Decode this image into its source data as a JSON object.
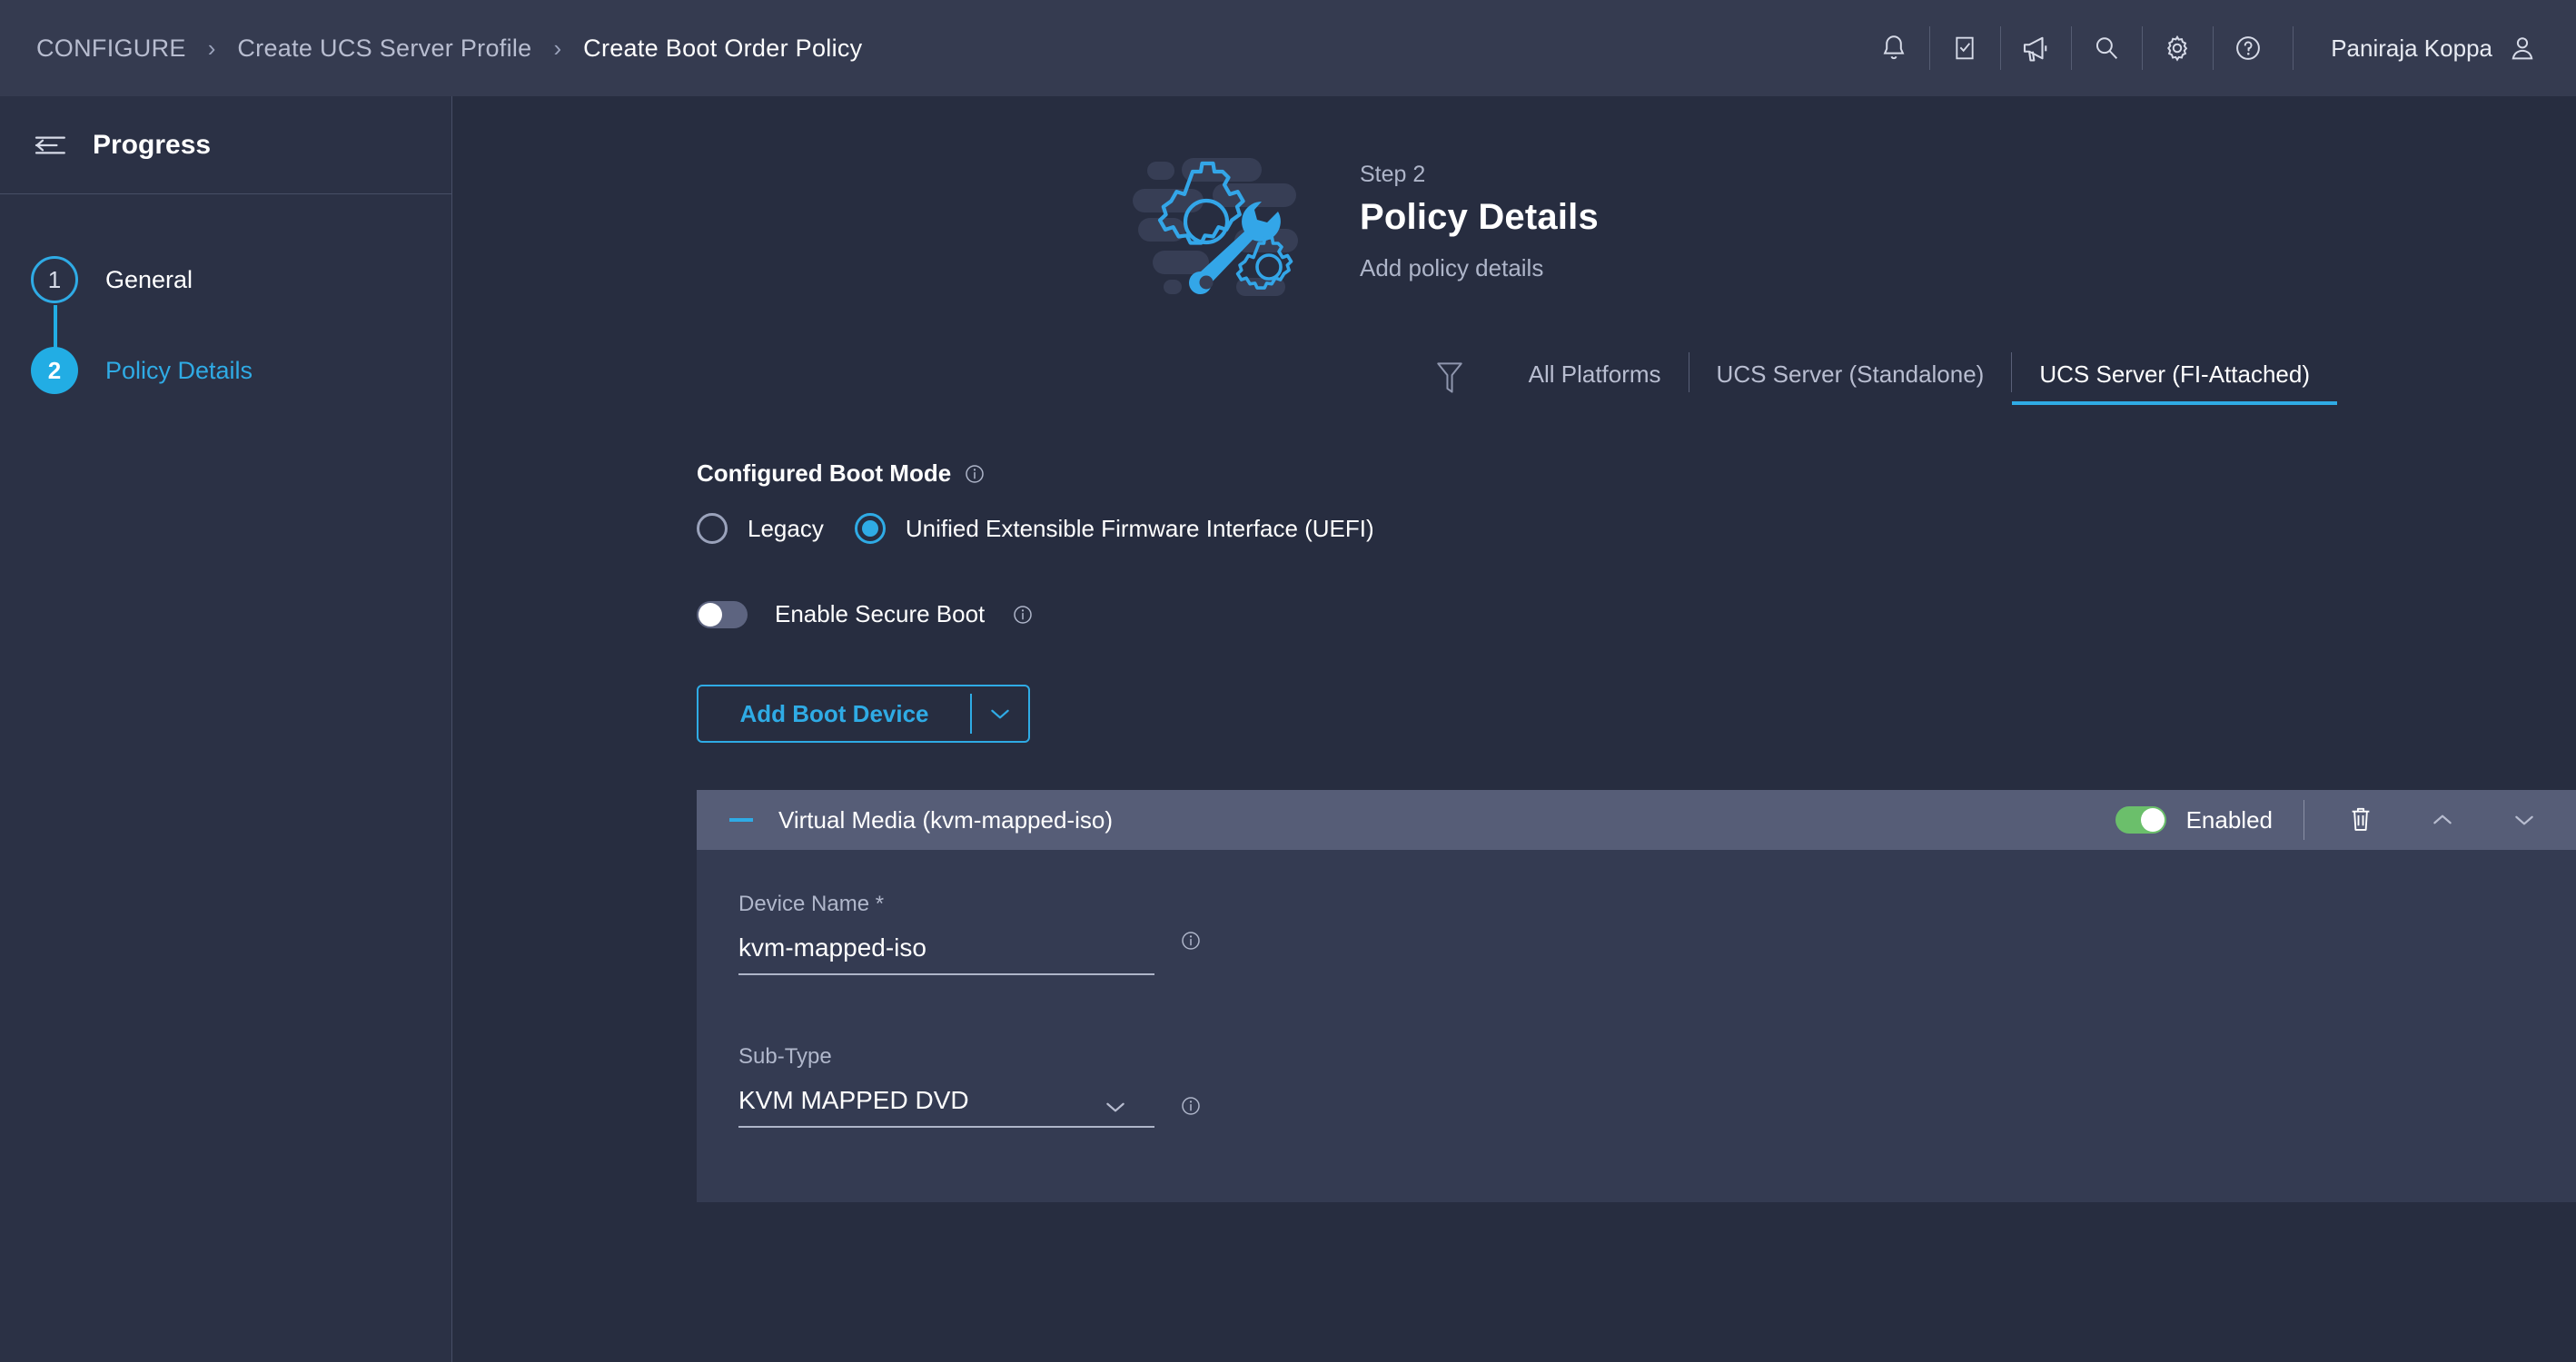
{
  "topbar": {
    "breadcrumb": [
      {
        "label": "CONFIGURE",
        "active": false
      },
      {
        "label": "Create UCS Server Profile",
        "active": false
      },
      {
        "label": "Create Boot Order Policy",
        "active": true
      }
    ],
    "separator": "›",
    "icons": [
      "bell-icon",
      "checklist-icon",
      "megaphone-icon",
      "search-icon",
      "gear-icon",
      "help-icon"
    ],
    "user": "Paniraja Koppa"
  },
  "sidebar": {
    "collapse_icon": "collapse-panel-icon",
    "title": "Progress",
    "steps": [
      {
        "number": "1",
        "label": "General",
        "state": "todo"
      },
      {
        "number": "2",
        "label": "Policy Details",
        "state": "current"
      }
    ]
  },
  "page": {
    "step_kicker": "Step 2",
    "title": "Policy Details",
    "subtitle": "Add policy details",
    "illustration": "gear-wrench-illustration"
  },
  "tabs": {
    "filter_icon": "filter-icon",
    "items": [
      {
        "label": "All Platforms",
        "selected": false
      },
      {
        "label": "UCS Server (Standalone)",
        "selected": false
      },
      {
        "label": "UCS Server (FI-Attached)",
        "selected": true
      }
    ]
  },
  "boot_mode": {
    "label": "Configured Boot Mode",
    "info_icon": "info-icon",
    "options": [
      {
        "label": "Legacy",
        "selected": false
      },
      {
        "label": "Unified Extensible Firmware Interface (UEFI)",
        "selected": true
      }
    ]
  },
  "secure_boot": {
    "label": "Enable Secure Boot",
    "info_icon": "info-icon",
    "state": "off"
  },
  "add_boot_device": {
    "label": "Add Boot Device",
    "caret_icon": "chevron-down-icon"
  },
  "device_card": {
    "collapse_icon": "minus-icon",
    "title": "Virtual Media (kvm-mapped-iso)",
    "toggle_state": "on",
    "toggle_label": "Enabled",
    "delete_icon": "trash-icon",
    "move_up_icon": "chevron-up-icon",
    "move_down_icon": "chevron-down-icon",
    "fields": [
      {
        "label": "Device Name *",
        "value": "kvm-mapped-iso",
        "placeholder": "",
        "type": "text",
        "info_icon": "info-icon"
      },
      {
        "label": "Sub-Type",
        "value": "KVM MAPPED DVD",
        "placeholder": "",
        "type": "select",
        "caret_icon": "chevron-down-icon",
        "info_icon": "info-icon"
      }
    ]
  },
  "colors": {
    "accent_blue": "#2fabe5",
    "toggle_green": "#6bbf6b",
    "topbar_bg": "#353b50",
    "sidebar_bg": "#2b3145",
    "main_bg": "#272d40",
    "card_bg": "#343b52",
    "card_header_bg": "#565d77"
  }
}
